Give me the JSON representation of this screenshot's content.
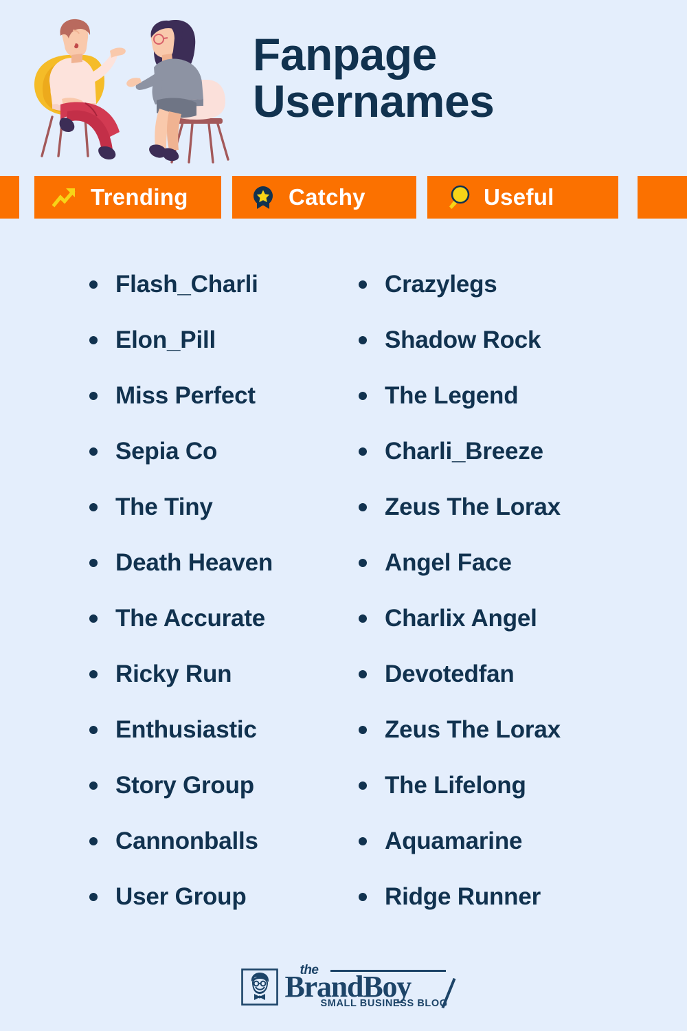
{
  "background_color": "#e4eefc",
  "accent_color": "#fb7100",
  "text_color": "#11324f",
  "icon_yellow": "#f7d417",
  "header": {
    "title_line1": "Fanpage",
    "title_line2": "Usernames",
    "illustration_name": "two-people-talking-illustration"
  },
  "tags": [
    {
      "label": "Trending",
      "icon": "trending-up-icon"
    },
    {
      "label": "Catchy",
      "icon": "award-star-icon"
    },
    {
      "label": "Useful",
      "icon": "magnifying-glass-icon"
    }
  ],
  "lists": {
    "left_column": [
      "Flash_Charli",
      "Elon_Pill",
      "Miss Perfect",
      "Sepia Co",
      "The Tiny",
      "Death Heaven",
      "The Accurate",
      "Ricky Run",
      "Enthusiastic",
      "Story Group",
      "Cannonballs",
      "User Group"
    ],
    "right_column": [
      "Crazylegs",
      "Shadow Rock",
      "The Legend",
      "Charli_Breeze",
      "Zeus The Lorax",
      "Angel Face",
      "Charlix Angel",
      "Devotedfan",
      "Zeus The Lorax",
      "The Lifelong",
      "Aquamarine",
      "Ridge Runner"
    ]
  },
  "footer": {
    "logo_the": "the",
    "logo_name": "BrandBoy",
    "logo_tagline": "SMALL BUSINESS BLOG",
    "logo_mark": "boy-face-logo-icon"
  }
}
